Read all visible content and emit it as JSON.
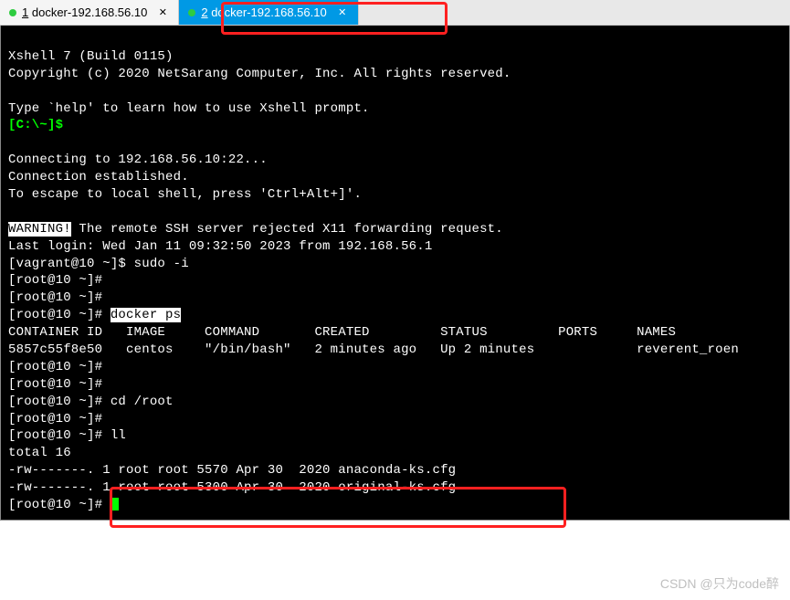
{
  "tabs": [
    {
      "num": "1",
      "label": "docker-192.168.56.10",
      "active": false
    },
    {
      "num": "2",
      "label": "docker-192.168.56.10",
      "active": true
    }
  ],
  "terminal": {
    "banner1": "Xshell 7 (Build 0115)",
    "banner2": "Copyright (c) 2020 NetSarang Computer, Inc. All rights reserved.",
    "banner3": "Type `help' to learn how to use Xshell prompt.",
    "prompt_local": "[C:\\~]$",
    "connect1": "Connecting to 192.168.56.10:22...",
    "connect2": "Connection established.",
    "connect3": "To escape to local shell, press 'Ctrl+Alt+]'.",
    "warning_label": "WARNING!",
    "warning_text": " The remote SSH server rejected X11 forwarding request.",
    "last_login": "Last login: Wed Jan 11 09:32:50 2023 from 192.168.56.1",
    "vagrant_prompt": "[vagrant@10 ~]$ ",
    "sudo_cmd": "sudo -i",
    "root_prompt": "[root@10 ~]# ",
    "docker_cmd": "docker ps",
    "ps_header": "CONTAINER ID   IMAGE     COMMAND       CREATED         STATUS         PORTS     NAMES",
    "ps_row": "5857c55f8e50   centos    \"/bin/bash\"   2 minutes ago   Up 2 minutes             reverent_roen",
    "cd_cmd": "cd /root",
    "ll_cmd": "ll",
    "ls_total": "total 16",
    "ls_row1": "-rw-------. 1 root root 5570 Apr 30  2020 anaconda-ks.cfg",
    "ls_row2": "-rw-------. 1 root root 5300 Apr 30  2020 original-ks.cfg"
  },
  "watermark": "CSDN @只为code醉"
}
